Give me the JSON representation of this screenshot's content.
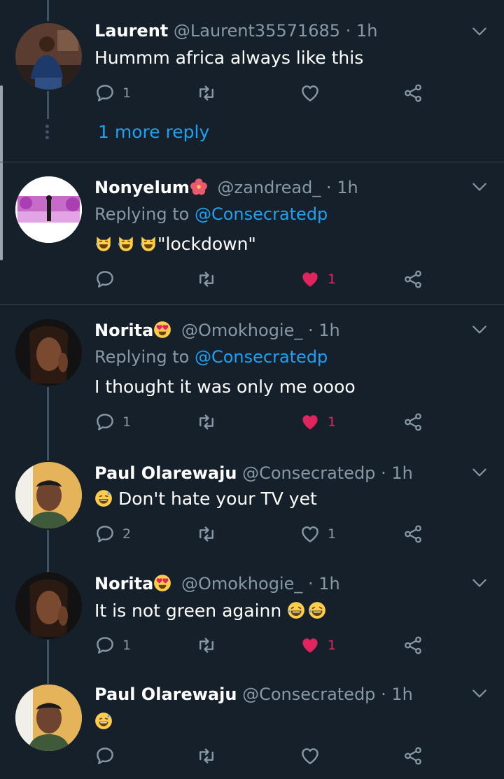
{
  "tweets": [
    {
      "name": "Laurent",
      "handle": "@Laurent35571685",
      "time": "· 1h",
      "text": "Hummm africa always like this",
      "replies": "1",
      "retweets": "",
      "likes": "",
      "liked": false
    },
    {
      "name": "Nonyelum",
      "handle": "@zandread_",
      "time": "· 1h",
      "replying_prefix": "Replying to",
      "replying_to": "@Consecratedp",
      "text": "\"lockdown\"",
      "replies": "",
      "retweets": "",
      "likes": "1",
      "liked": true
    },
    {
      "name": "Norita",
      "handle": "@Omokhogie_",
      "time": "· 1h",
      "replying_prefix": "Replying to",
      "replying_to": "@Consecratedp",
      "text": "I thought it was only me oooo",
      "replies": "1",
      "retweets": "",
      "likes": "1",
      "liked": true
    },
    {
      "name": "Paul Olarewaju",
      "handle": "@Consecratedp",
      "time": "· 1h",
      "text": "Don't hate your TV yet",
      "replies": "2",
      "retweets": "",
      "likes": "1",
      "liked": false
    },
    {
      "name": "Norita",
      "handle": "@Omokhogie_",
      "time": "· 1h",
      "text": "It is not green againn",
      "replies": "1",
      "retweets": "",
      "likes": "1",
      "liked": true
    },
    {
      "name": "Paul Olarewaju",
      "handle": "@Consecratedp",
      "time": "· 1h",
      "text": "",
      "replies": "",
      "retweets": "",
      "likes": "",
      "liked": false
    }
  ],
  "more_reply": "1 more reply",
  "colors": {
    "background": "#15202b",
    "link": "#1da1f2",
    "like": "#e0245e",
    "muted": "#8899a6"
  }
}
